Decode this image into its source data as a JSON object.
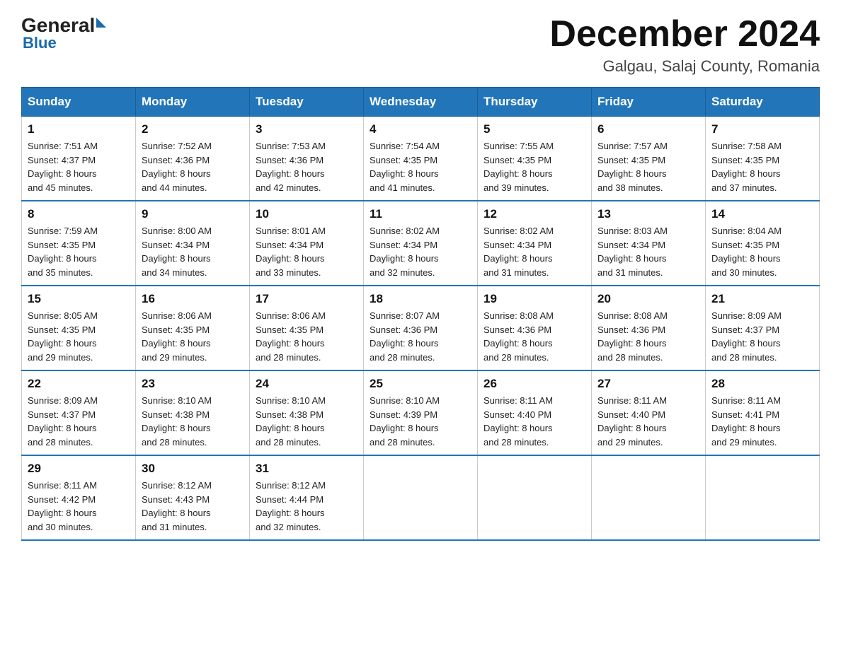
{
  "logo": {
    "general": "General",
    "blue": "Blue"
  },
  "header": {
    "title": "December 2024",
    "subtitle": "Galgau, Salaj County, Romania"
  },
  "weekdays": [
    "Sunday",
    "Monday",
    "Tuesday",
    "Wednesday",
    "Thursday",
    "Friday",
    "Saturday"
  ],
  "weeks": [
    [
      {
        "day": "1",
        "sunrise": "7:51 AM",
        "sunset": "4:37 PM",
        "daylight": "8 hours and 45 minutes."
      },
      {
        "day": "2",
        "sunrise": "7:52 AM",
        "sunset": "4:36 PM",
        "daylight": "8 hours and 44 minutes."
      },
      {
        "day": "3",
        "sunrise": "7:53 AM",
        "sunset": "4:36 PM",
        "daylight": "8 hours and 42 minutes."
      },
      {
        "day": "4",
        "sunrise": "7:54 AM",
        "sunset": "4:35 PM",
        "daylight": "8 hours and 41 minutes."
      },
      {
        "day": "5",
        "sunrise": "7:55 AM",
        "sunset": "4:35 PM",
        "daylight": "8 hours and 39 minutes."
      },
      {
        "day": "6",
        "sunrise": "7:57 AM",
        "sunset": "4:35 PM",
        "daylight": "8 hours and 38 minutes."
      },
      {
        "day": "7",
        "sunrise": "7:58 AM",
        "sunset": "4:35 PM",
        "daylight": "8 hours and 37 minutes."
      }
    ],
    [
      {
        "day": "8",
        "sunrise": "7:59 AM",
        "sunset": "4:35 PM",
        "daylight": "8 hours and 35 minutes."
      },
      {
        "day": "9",
        "sunrise": "8:00 AM",
        "sunset": "4:34 PM",
        "daylight": "8 hours and 34 minutes."
      },
      {
        "day": "10",
        "sunrise": "8:01 AM",
        "sunset": "4:34 PM",
        "daylight": "8 hours and 33 minutes."
      },
      {
        "day": "11",
        "sunrise": "8:02 AM",
        "sunset": "4:34 PM",
        "daylight": "8 hours and 32 minutes."
      },
      {
        "day": "12",
        "sunrise": "8:02 AM",
        "sunset": "4:34 PM",
        "daylight": "8 hours and 31 minutes."
      },
      {
        "day": "13",
        "sunrise": "8:03 AM",
        "sunset": "4:34 PM",
        "daylight": "8 hours and 31 minutes."
      },
      {
        "day": "14",
        "sunrise": "8:04 AM",
        "sunset": "4:35 PM",
        "daylight": "8 hours and 30 minutes."
      }
    ],
    [
      {
        "day": "15",
        "sunrise": "8:05 AM",
        "sunset": "4:35 PM",
        "daylight": "8 hours and 29 minutes."
      },
      {
        "day": "16",
        "sunrise": "8:06 AM",
        "sunset": "4:35 PM",
        "daylight": "8 hours and 29 minutes."
      },
      {
        "day": "17",
        "sunrise": "8:06 AM",
        "sunset": "4:35 PM",
        "daylight": "8 hours and 28 minutes."
      },
      {
        "day": "18",
        "sunrise": "8:07 AM",
        "sunset": "4:36 PM",
        "daylight": "8 hours and 28 minutes."
      },
      {
        "day": "19",
        "sunrise": "8:08 AM",
        "sunset": "4:36 PM",
        "daylight": "8 hours and 28 minutes."
      },
      {
        "day": "20",
        "sunrise": "8:08 AM",
        "sunset": "4:36 PM",
        "daylight": "8 hours and 28 minutes."
      },
      {
        "day": "21",
        "sunrise": "8:09 AM",
        "sunset": "4:37 PM",
        "daylight": "8 hours and 28 minutes."
      }
    ],
    [
      {
        "day": "22",
        "sunrise": "8:09 AM",
        "sunset": "4:37 PM",
        "daylight": "8 hours and 28 minutes."
      },
      {
        "day": "23",
        "sunrise": "8:10 AM",
        "sunset": "4:38 PM",
        "daylight": "8 hours and 28 minutes."
      },
      {
        "day": "24",
        "sunrise": "8:10 AM",
        "sunset": "4:38 PM",
        "daylight": "8 hours and 28 minutes."
      },
      {
        "day": "25",
        "sunrise": "8:10 AM",
        "sunset": "4:39 PM",
        "daylight": "8 hours and 28 minutes."
      },
      {
        "day": "26",
        "sunrise": "8:11 AM",
        "sunset": "4:40 PM",
        "daylight": "8 hours and 28 minutes."
      },
      {
        "day": "27",
        "sunrise": "8:11 AM",
        "sunset": "4:40 PM",
        "daylight": "8 hours and 29 minutes."
      },
      {
        "day": "28",
        "sunrise": "8:11 AM",
        "sunset": "4:41 PM",
        "daylight": "8 hours and 29 minutes."
      }
    ],
    [
      {
        "day": "29",
        "sunrise": "8:11 AM",
        "sunset": "4:42 PM",
        "daylight": "8 hours and 30 minutes."
      },
      {
        "day": "30",
        "sunrise": "8:12 AM",
        "sunset": "4:43 PM",
        "daylight": "8 hours and 31 minutes."
      },
      {
        "day": "31",
        "sunrise": "8:12 AM",
        "sunset": "4:44 PM",
        "daylight": "8 hours and 32 minutes."
      },
      null,
      null,
      null,
      null
    ]
  ],
  "labels": {
    "sunrise": "Sunrise:",
    "sunset": "Sunset:",
    "daylight": "Daylight:"
  }
}
